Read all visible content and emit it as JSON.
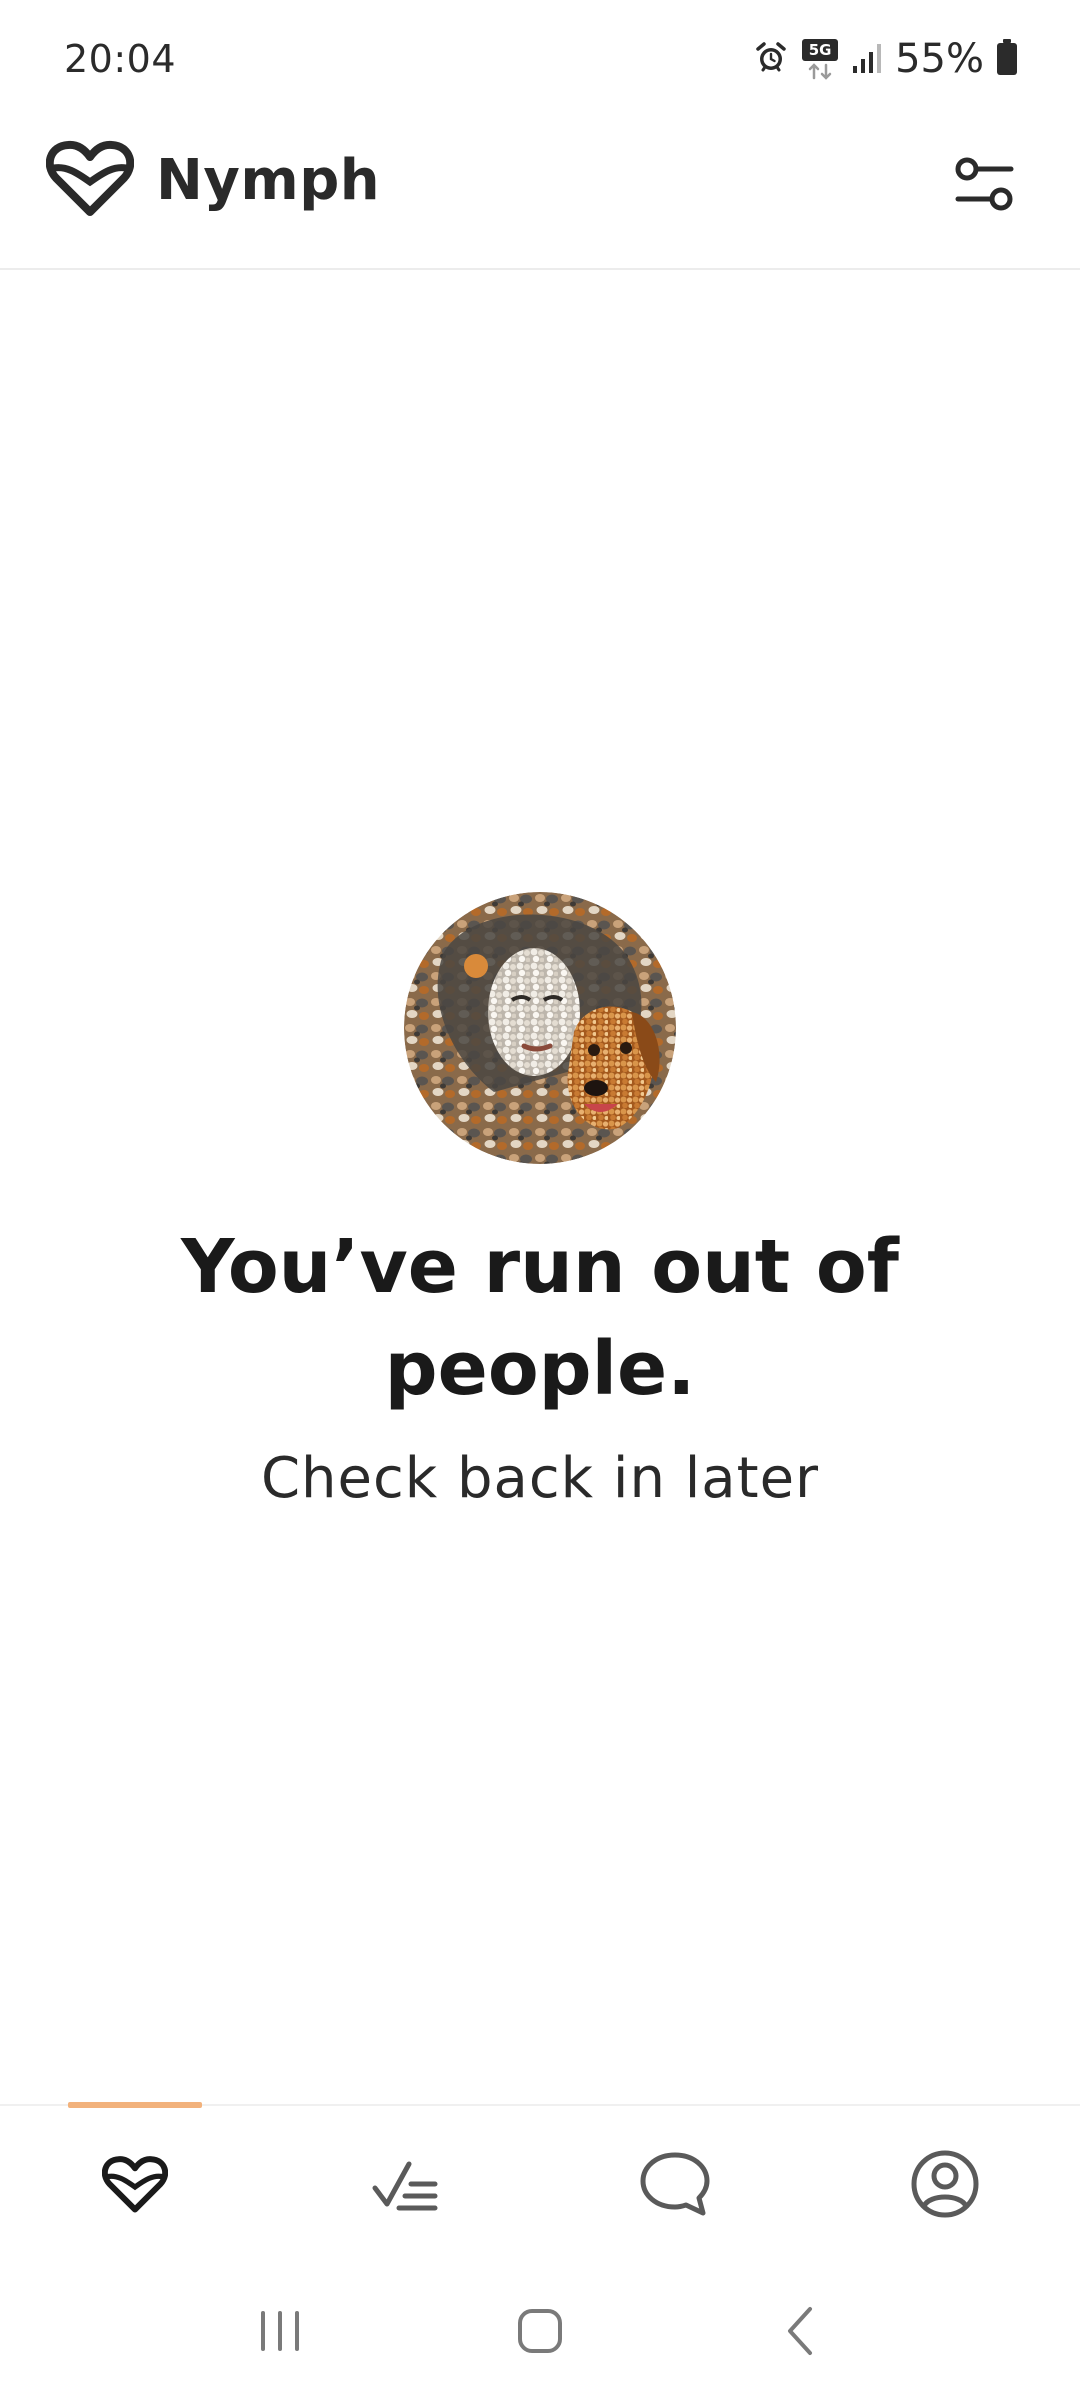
{
  "status_bar": {
    "time": "20:04",
    "network": "5G",
    "battery": "55%"
  },
  "header": {
    "brand_name": "Nymph",
    "logo_icon": "heart-logo-icon",
    "filter_icon": "filter-settings-icon"
  },
  "empty_state": {
    "title": "You’ve run out of people.",
    "subtitle": "Check back in later",
    "image": "woman-and-dog-pebble-mosaic"
  },
  "bottom_nav": {
    "active_index": 0,
    "items": [
      {
        "id": "discover",
        "icon": "heart-icon"
      },
      {
        "id": "likes",
        "icon": "checklist-icon"
      },
      {
        "id": "chats",
        "icon": "chat-bubble-icon"
      },
      {
        "id": "profile",
        "icon": "profile-icon"
      }
    ],
    "accent_color": "#f2b27c"
  },
  "system_nav": {
    "buttons": [
      "recents",
      "home",
      "back"
    ]
  }
}
